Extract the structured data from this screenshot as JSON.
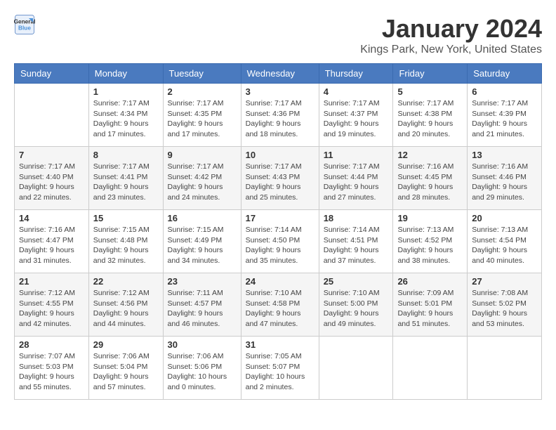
{
  "header": {
    "logo_line1": "General",
    "logo_line2": "Blue",
    "title": "January 2024",
    "subtitle": "Kings Park, New York, United States"
  },
  "days_of_week": [
    "Sunday",
    "Monday",
    "Tuesday",
    "Wednesday",
    "Thursday",
    "Friday",
    "Saturday"
  ],
  "weeks": [
    [
      {
        "day": "",
        "info": ""
      },
      {
        "day": "1",
        "info": "Sunrise: 7:17 AM\nSunset: 4:34 PM\nDaylight: 9 hours\nand 17 minutes."
      },
      {
        "day": "2",
        "info": "Sunrise: 7:17 AM\nSunset: 4:35 PM\nDaylight: 9 hours\nand 17 minutes."
      },
      {
        "day": "3",
        "info": "Sunrise: 7:17 AM\nSunset: 4:36 PM\nDaylight: 9 hours\nand 18 minutes."
      },
      {
        "day": "4",
        "info": "Sunrise: 7:17 AM\nSunset: 4:37 PM\nDaylight: 9 hours\nand 19 minutes."
      },
      {
        "day": "5",
        "info": "Sunrise: 7:17 AM\nSunset: 4:38 PM\nDaylight: 9 hours\nand 20 minutes."
      },
      {
        "day": "6",
        "info": "Sunrise: 7:17 AM\nSunset: 4:39 PM\nDaylight: 9 hours\nand 21 minutes."
      }
    ],
    [
      {
        "day": "7",
        "info": "Sunrise: 7:17 AM\nSunset: 4:40 PM\nDaylight: 9 hours\nand 22 minutes."
      },
      {
        "day": "8",
        "info": "Sunrise: 7:17 AM\nSunset: 4:41 PM\nDaylight: 9 hours\nand 23 minutes."
      },
      {
        "day": "9",
        "info": "Sunrise: 7:17 AM\nSunset: 4:42 PM\nDaylight: 9 hours\nand 24 minutes."
      },
      {
        "day": "10",
        "info": "Sunrise: 7:17 AM\nSunset: 4:43 PM\nDaylight: 9 hours\nand 25 minutes."
      },
      {
        "day": "11",
        "info": "Sunrise: 7:17 AM\nSunset: 4:44 PM\nDaylight: 9 hours\nand 27 minutes."
      },
      {
        "day": "12",
        "info": "Sunrise: 7:16 AM\nSunset: 4:45 PM\nDaylight: 9 hours\nand 28 minutes."
      },
      {
        "day": "13",
        "info": "Sunrise: 7:16 AM\nSunset: 4:46 PM\nDaylight: 9 hours\nand 29 minutes."
      }
    ],
    [
      {
        "day": "14",
        "info": "Sunrise: 7:16 AM\nSunset: 4:47 PM\nDaylight: 9 hours\nand 31 minutes."
      },
      {
        "day": "15",
        "info": "Sunrise: 7:15 AM\nSunset: 4:48 PM\nDaylight: 9 hours\nand 32 minutes."
      },
      {
        "day": "16",
        "info": "Sunrise: 7:15 AM\nSunset: 4:49 PM\nDaylight: 9 hours\nand 34 minutes."
      },
      {
        "day": "17",
        "info": "Sunrise: 7:14 AM\nSunset: 4:50 PM\nDaylight: 9 hours\nand 35 minutes."
      },
      {
        "day": "18",
        "info": "Sunrise: 7:14 AM\nSunset: 4:51 PM\nDaylight: 9 hours\nand 37 minutes."
      },
      {
        "day": "19",
        "info": "Sunrise: 7:13 AM\nSunset: 4:52 PM\nDaylight: 9 hours\nand 38 minutes."
      },
      {
        "day": "20",
        "info": "Sunrise: 7:13 AM\nSunset: 4:54 PM\nDaylight: 9 hours\nand 40 minutes."
      }
    ],
    [
      {
        "day": "21",
        "info": "Sunrise: 7:12 AM\nSunset: 4:55 PM\nDaylight: 9 hours\nand 42 minutes."
      },
      {
        "day": "22",
        "info": "Sunrise: 7:12 AM\nSunset: 4:56 PM\nDaylight: 9 hours\nand 44 minutes."
      },
      {
        "day": "23",
        "info": "Sunrise: 7:11 AM\nSunset: 4:57 PM\nDaylight: 9 hours\nand 46 minutes."
      },
      {
        "day": "24",
        "info": "Sunrise: 7:10 AM\nSunset: 4:58 PM\nDaylight: 9 hours\nand 47 minutes."
      },
      {
        "day": "25",
        "info": "Sunrise: 7:10 AM\nSunset: 5:00 PM\nDaylight: 9 hours\nand 49 minutes."
      },
      {
        "day": "26",
        "info": "Sunrise: 7:09 AM\nSunset: 5:01 PM\nDaylight: 9 hours\nand 51 minutes."
      },
      {
        "day": "27",
        "info": "Sunrise: 7:08 AM\nSunset: 5:02 PM\nDaylight: 9 hours\nand 53 minutes."
      }
    ],
    [
      {
        "day": "28",
        "info": "Sunrise: 7:07 AM\nSunset: 5:03 PM\nDaylight: 9 hours\nand 55 minutes."
      },
      {
        "day": "29",
        "info": "Sunrise: 7:06 AM\nSunset: 5:04 PM\nDaylight: 9 hours\nand 57 minutes."
      },
      {
        "day": "30",
        "info": "Sunrise: 7:06 AM\nSunset: 5:06 PM\nDaylight: 10 hours\nand 0 minutes."
      },
      {
        "day": "31",
        "info": "Sunrise: 7:05 AM\nSunset: 5:07 PM\nDaylight: 10 hours\nand 2 minutes."
      },
      {
        "day": "",
        "info": ""
      },
      {
        "day": "",
        "info": ""
      },
      {
        "day": "",
        "info": ""
      }
    ]
  ]
}
